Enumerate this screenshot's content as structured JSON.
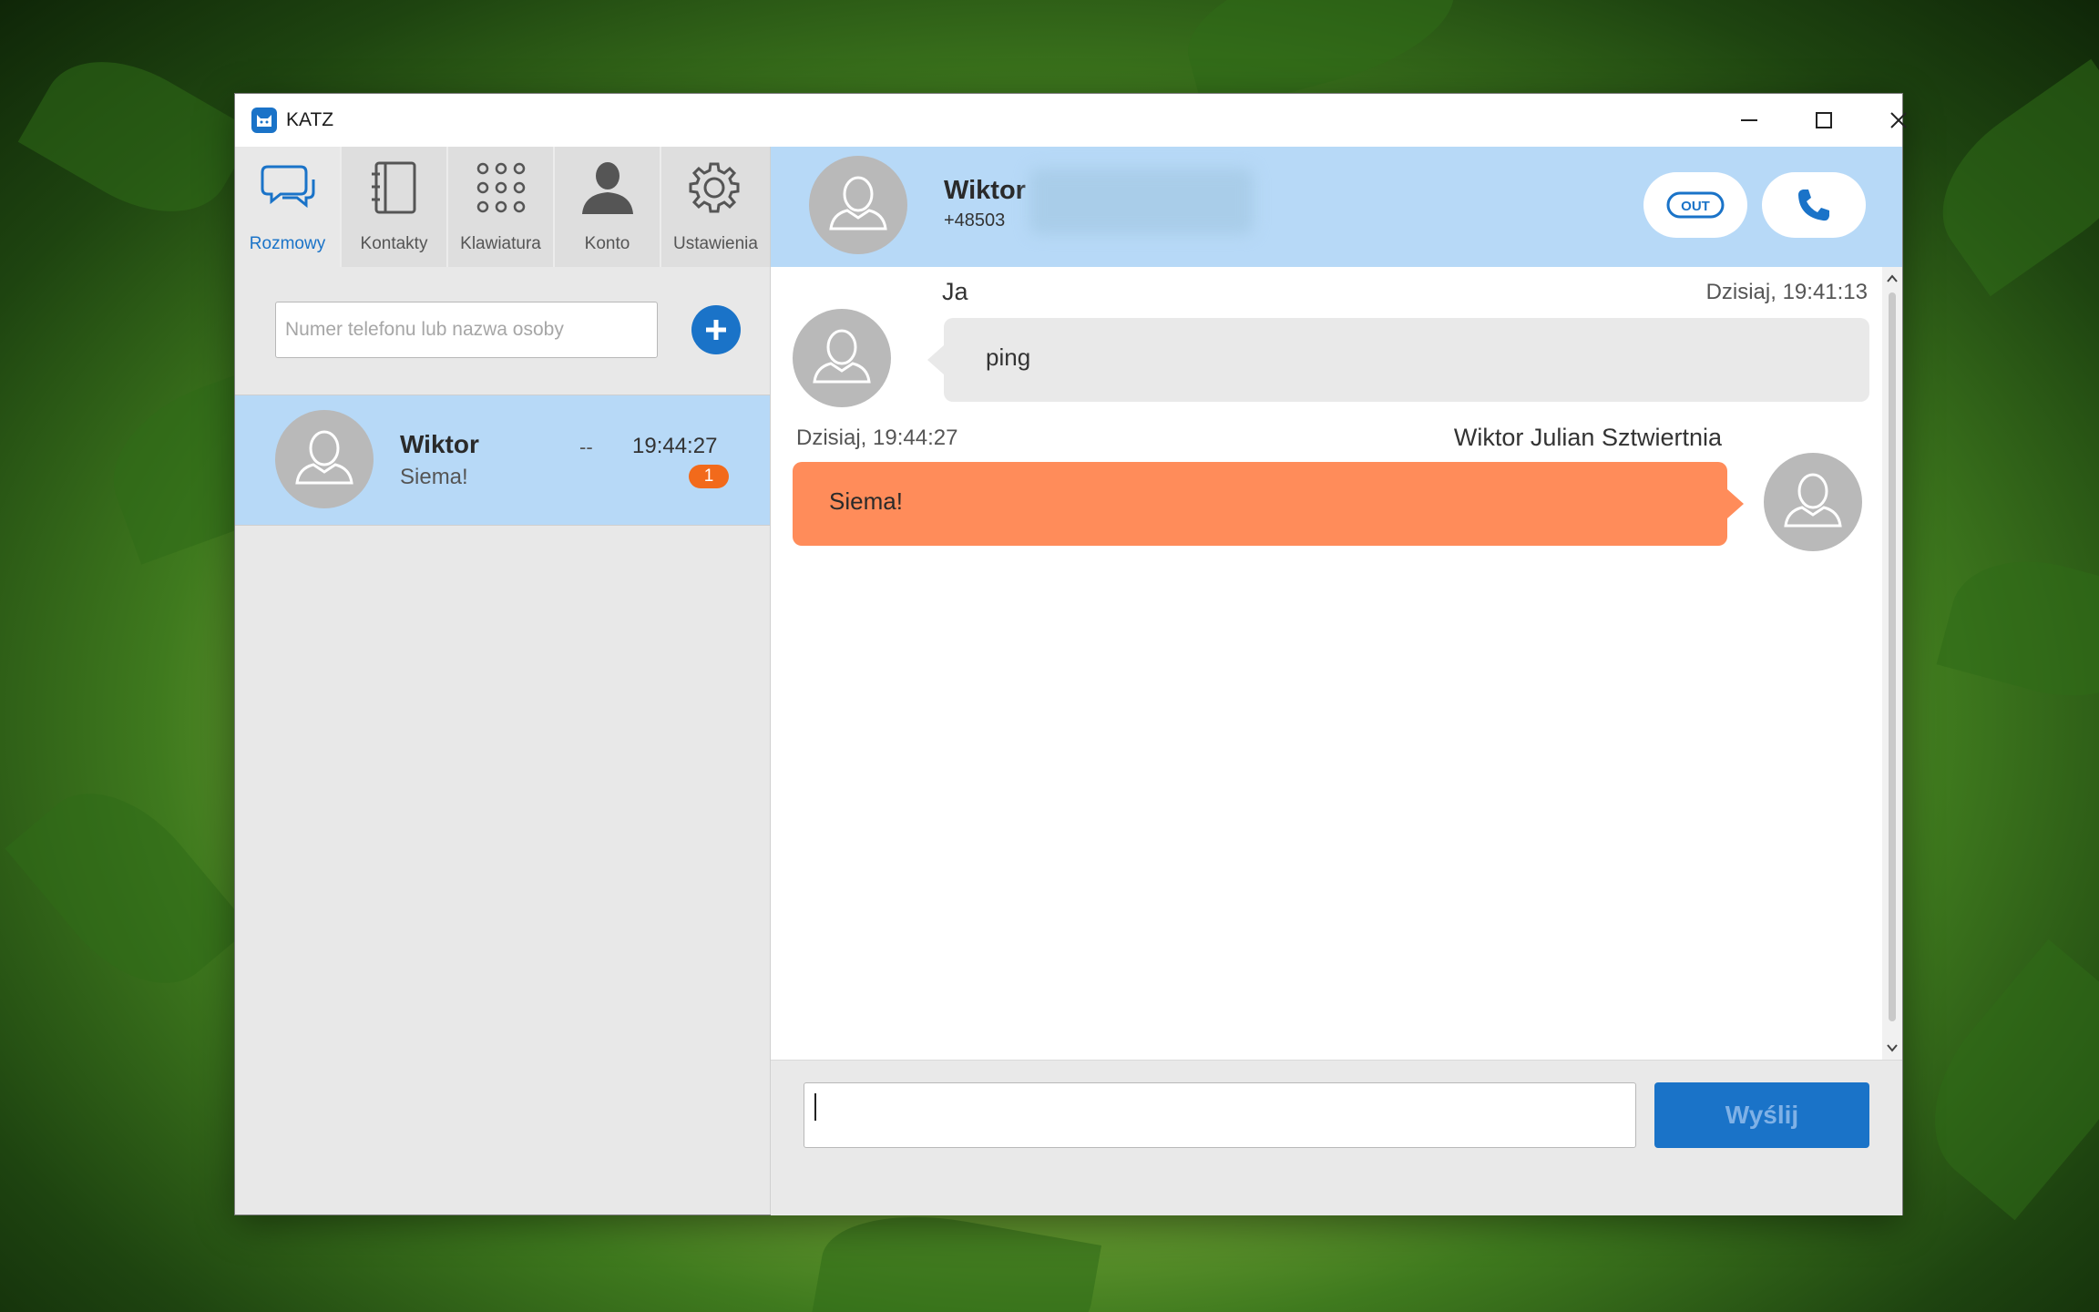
{
  "app": {
    "title": "KATZ"
  },
  "nav": [
    {
      "id": "rozmowy",
      "label": "Rozmowy",
      "active": true
    },
    {
      "id": "kontakty",
      "label": "Kontakty",
      "active": false
    },
    {
      "id": "klawiatura",
      "label": "Klawiatura",
      "active": false
    },
    {
      "id": "konto",
      "label": "Konto",
      "active": false
    },
    {
      "id": "ustawienia",
      "label": "Ustawienia",
      "active": false
    }
  ],
  "search": {
    "placeholder": "Numer telefonu lub nazwa osoby"
  },
  "conversation_list": [
    {
      "name": "Wiktor",
      "last_message": "Siema!",
      "status": "--",
      "time": "19:44:27",
      "unread": "1"
    }
  ],
  "chat": {
    "contact_name": "Wiktor",
    "contact_phone": "+48503",
    "out_label": "OUT",
    "messages": [
      {
        "sender": "Ja",
        "time": "Dzisiaj, 19:41:13",
        "text": "ping",
        "direction": "outgoing"
      },
      {
        "sender": "Wiktor Julian Sztwiertnia",
        "time": "Dzisiaj, 19:44:27",
        "text": "Siema!",
        "direction": "incoming"
      }
    ]
  },
  "composer": {
    "value": "",
    "send_label": "Wyślij"
  },
  "colors": {
    "accent": "#1a73c8",
    "selected_row": "#b7d9f7",
    "incoming_bubble": "#ff8c5a",
    "outgoing_bubble": "#e9e9e9",
    "badge": "#f26a1b"
  }
}
